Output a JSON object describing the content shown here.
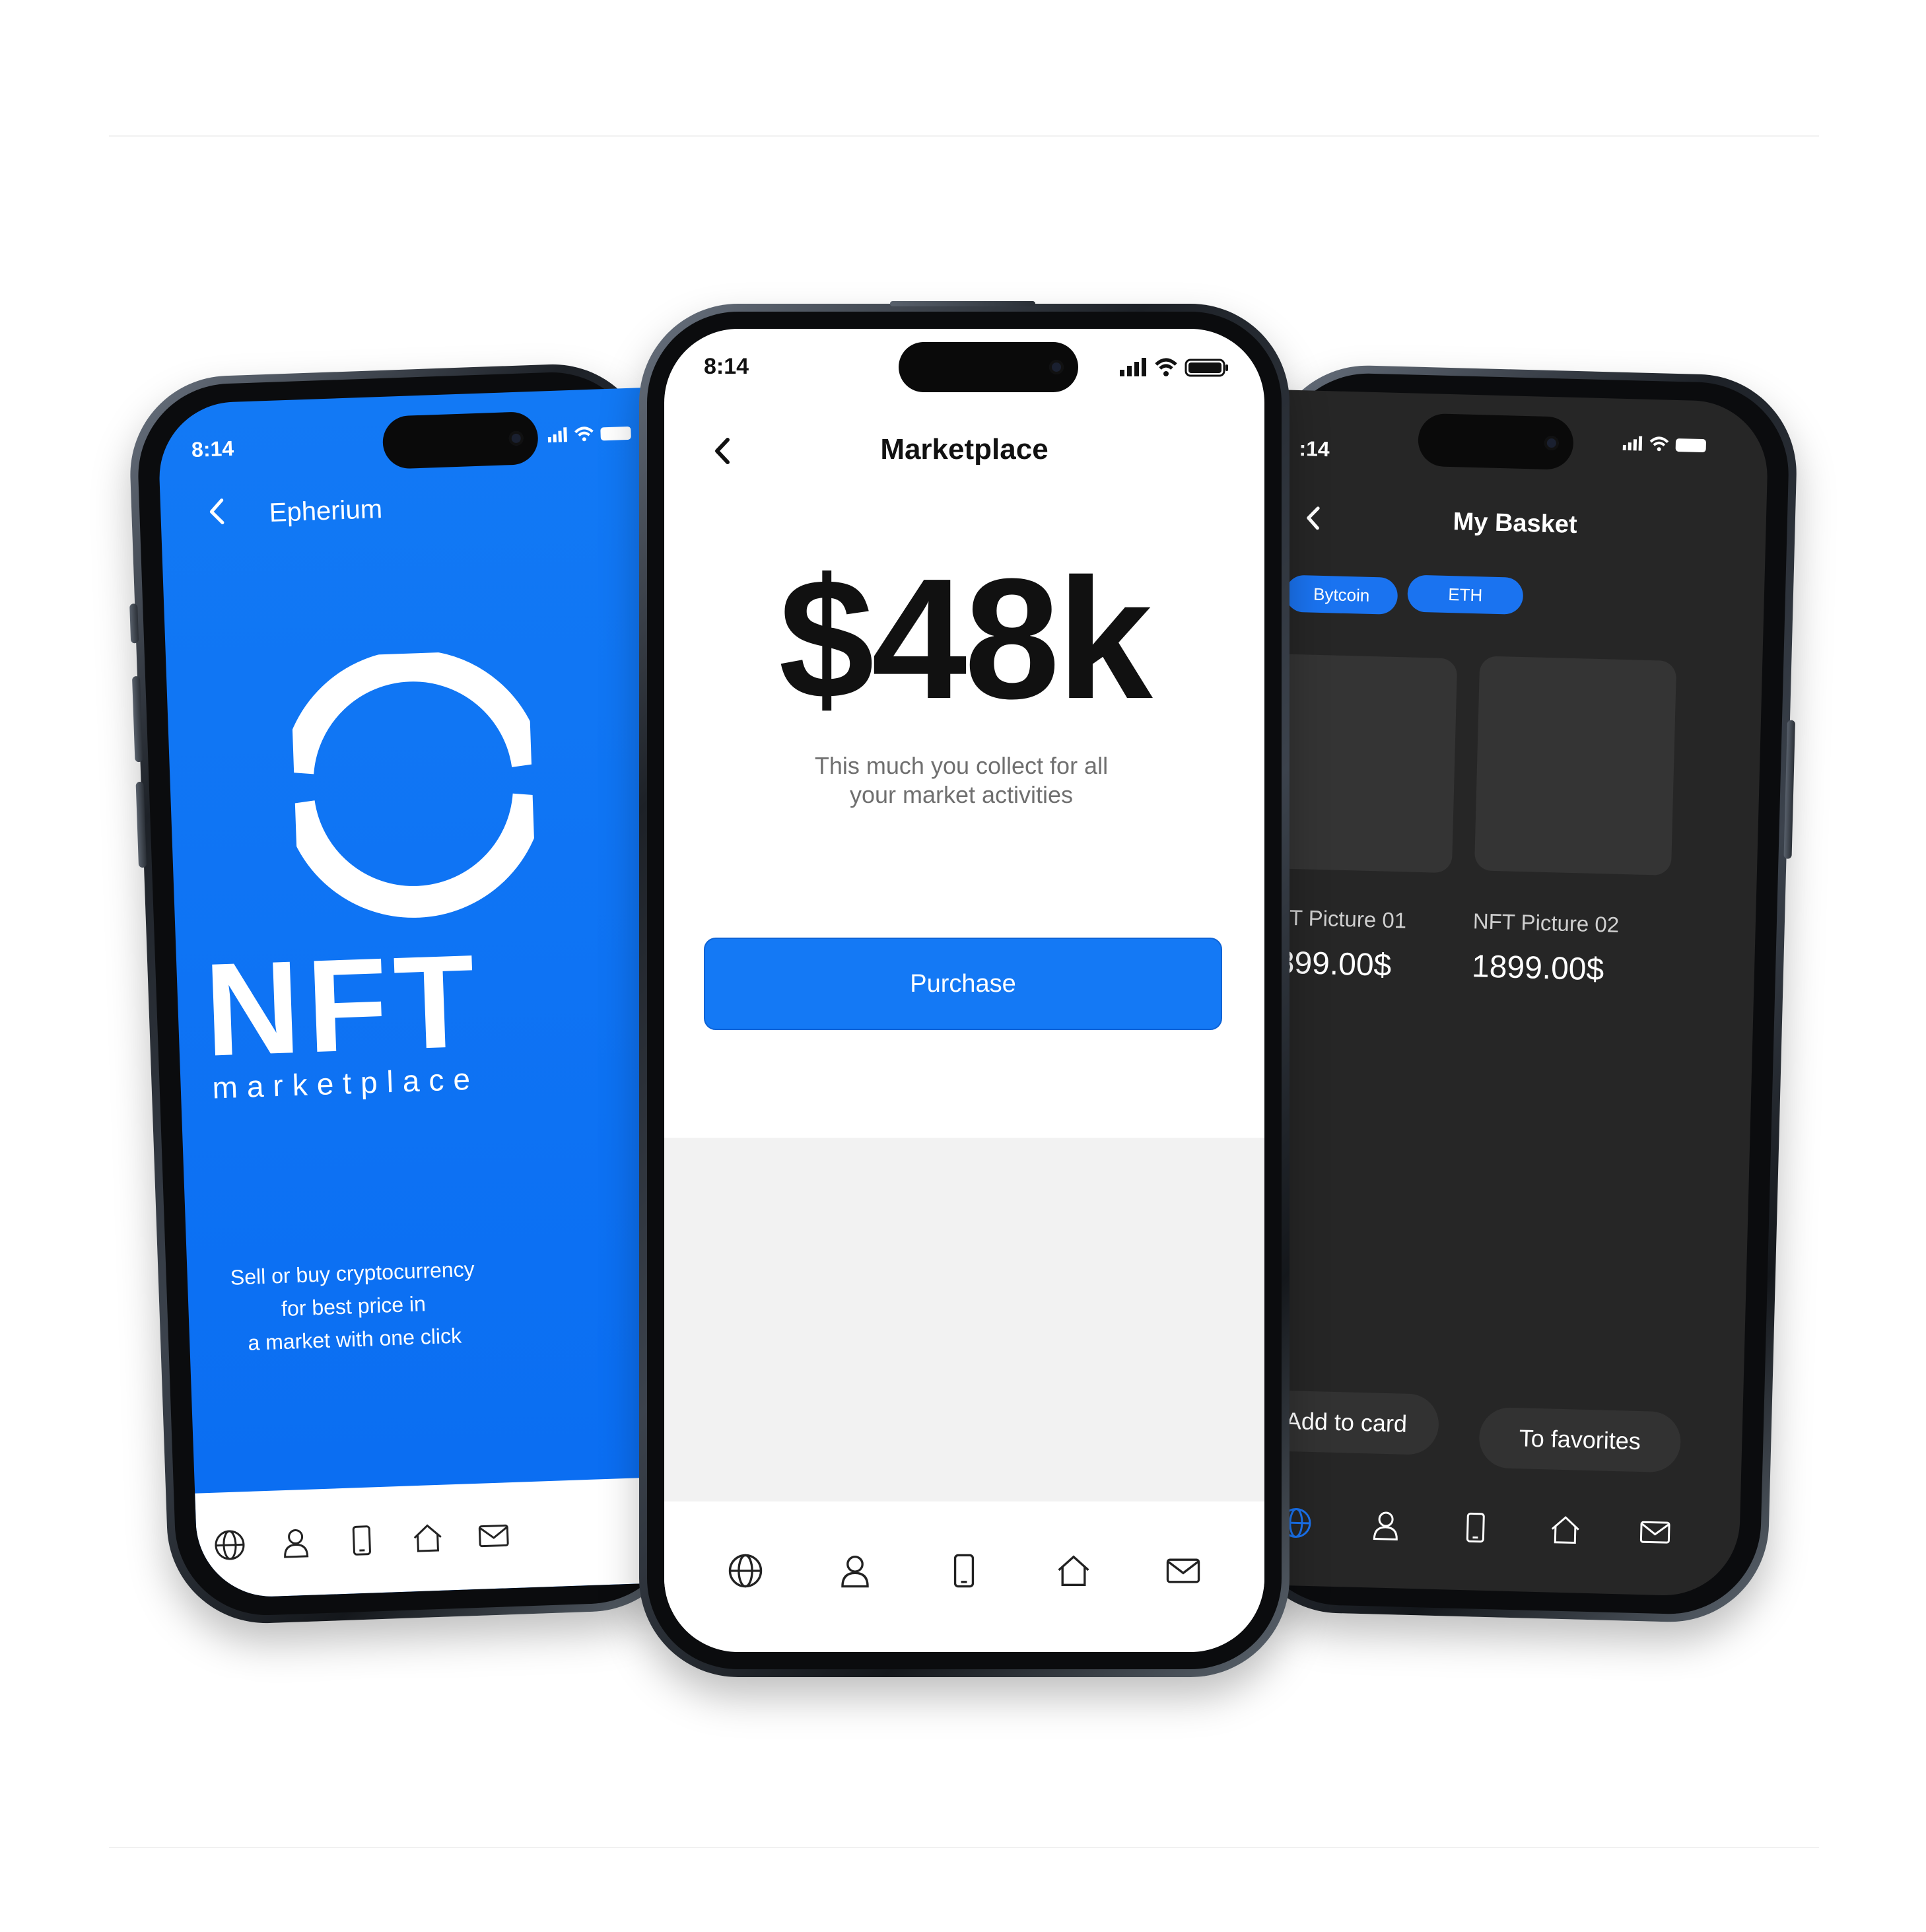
{
  "left_phone": {
    "status_time": "8:14",
    "title": "Epherium",
    "logo_main": "NFT",
    "logo_sub": "marketplace",
    "description_lines": [
      "Sell or buy cryptocurrency",
      "for best price in",
      "a market with one click"
    ],
    "accent_color": "#0a6df2",
    "nav_icons": [
      "globe-icon",
      "user-icon",
      "phone-icon",
      "home-icon",
      "mail-icon"
    ]
  },
  "center_phone": {
    "status_time": "8:14",
    "title": "Marketplace",
    "amount": "$48k",
    "description_lines": [
      "This much you collect for all",
      "your market activities"
    ],
    "purchase_label": "Purchase",
    "accent_color": "#1479f5",
    "nav_icons": [
      "globe-icon",
      "user-icon",
      "phone-icon",
      "home-icon",
      "mail-icon"
    ]
  },
  "right_phone": {
    "status_time": ":14",
    "title": "My Basket",
    "chips": [
      "Bytcoin",
      "ETH"
    ],
    "cards": [
      {
        "name": "NFT Picture 01",
        "price": "1899.00$"
      },
      {
        "name": "NFT Picture 02",
        "price": "1899.00$"
      }
    ],
    "add_label": "Add to card",
    "fav_label": "To favorites",
    "background_color": "#262626",
    "nav_icons": [
      "globe-icon",
      "user-icon",
      "phone-icon",
      "home-icon",
      "mail-icon"
    ]
  }
}
